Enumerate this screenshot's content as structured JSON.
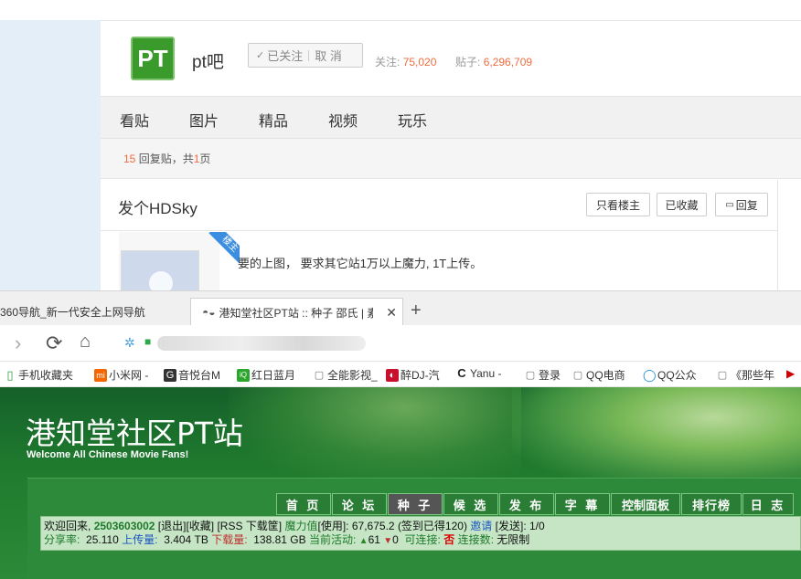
{
  "tieba": {
    "logo_text": "PT",
    "forum_name": "pt吧",
    "follow_label": "已关注",
    "cancel_label": "取 消",
    "followers_label": "关注:",
    "followers_value": "75,020",
    "posts_label": "贴子:",
    "posts_value": "6,296,709",
    "nav": [
      "看贴",
      "图片",
      "精品",
      "视频",
      "玩乐"
    ],
    "reply_count": "15",
    "reply_text_mid": "回复贴，共",
    "page_count": "1",
    "page_suffix": "页",
    "thread_title": "发个HDSky",
    "btn_op_only": "只看楼主",
    "btn_saved": "已收藏",
    "btn_reply": "回复",
    "badge": "楼主",
    "post_text": "要的上图， 要求其它站1万以上魔力, 1T上传。"
  },
  "browser": {
    "tab1_title": "360导航_新一代安全上网导航",
    "tab2_title": "港知堂社区PT站 :: 种子 邵氏 | 素",
    "new_tab": "+",
    "bookmarks": [
      {
        "label": "手机收藏夹",
        "icon": "phone-icon"
      },
      {
        "label": "小米网 -",
        "icon": "mi-icon"
      },
      {
        "label": "音悦台M",
        "icon": "g-icon"
      },
      {
        "label": "红日蓝月",
        "icon": "iqiyi-icon"
      },
      {
        "label": "全能影视_",
        "icon": "page-icon"
      },
      {
        "label": "醉DJ-汽",
        "icon": "dj-icon"
      },
      {
        "label": "Yanu -",
        "icon": "c-icon"
      },
      {
        "label": "登录",
        "icon": "page-icon"
      },
      {
        "label": "QQ电商",
        "icon": "page-icon"
      },
      {
        "label": "QQ公众",
        "icon": "qq-icon"
      },
      {
        "label": "《那些年",
        "icon": "page-icon"
      }
    ]
  },
  "site": {
    "title": "港知堂社区PT站",
    "subtitle": "Welcome All Chinese Movie Fans!",
    "nav": [
      "首 页",
      "论 坛",
      "种 子",
      "候 选",
      "发 布",
      "字 幕",
      "控制面板",
      "排行榜",
      "日 志"
    ],
    "active_nav": "种 子",
    "welcome": "欢迎回来,",
    "username": "2503603002",
    "logout": "[退出]",
    "favorites": "[收藏]",
    "rss": "[RSS 下载筐]",
    "bonus_label": "魔力值",
    "bonus_use": "[使用]:",
    "bonus_value": "67,675.2",
    "signin": "(签到已得120)",
    "invite": "邀请",
    "sent": "[发送]: 1/0",
    "ratio_label": "分享率:",
    "ratio_value": "25.110",
    "upload_label": "上传量:",
    "upload_value": "3.404 TB",
    "download_label": "下载量:",
    "download_value": "138.81 GB",
    "activity_label": "当前活动:",
    "seeding": "61",
    "leeching": "0",
    "connectable_label": "可连接:",
    "connectable_value": "否",
    "connections_label": "连接数:",
    "connections_value": "无限制"
  }
}
